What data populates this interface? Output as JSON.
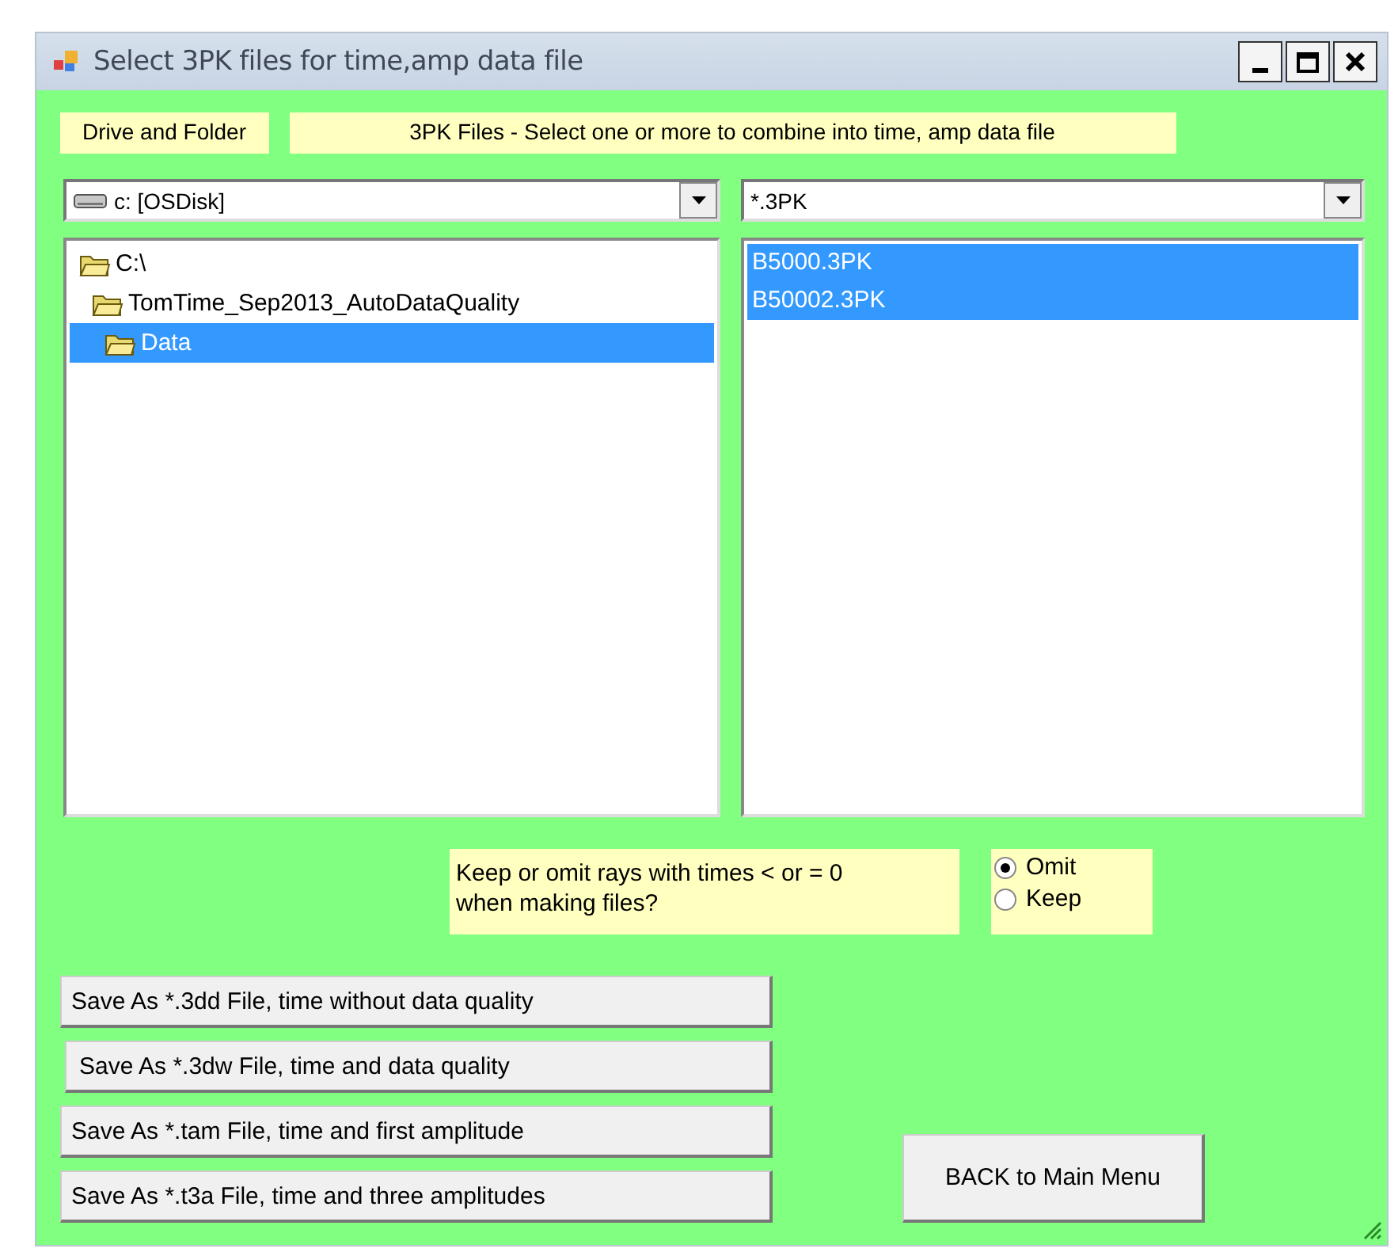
{
  "window": {
    "title": "Select  3PK  files  for  time,amp data file"
  },
  "drive_label": "Drive and Folder",
  "files_label": "3PK Files - Select one or more to combine into time, amp data file",
  "drive_combo": {
    "value": "c: [OSDisk]"
  },
  "filter_combo": {
    "value": "*.3PK"
  },
  "folder_tree": [
    {
      "label": "C:\\",
      "selected": false,
      "children": [
        {
          "label": "TomTime_Sep2013_AutoDataQuality",
          "selected": false,
          "children": [
            {
              "label": "Data",
              "selected": true
            }
          ]
        }
      ]
    }
  ],
  "files": [
    {
      "name": "B5000.3PK",
      "selected": true
    },
    {
      "name": "B50002.3PK",
      "selected": true
    }
  ],
  "omit_question": "Keep or omit rays with times < or = 0\nwhen making files?",
  "rays_options": [
    {
      "label": "Omit",
      "selected": true
    },
    {
      "label": "Keep",
      "selected": false
    }
  ],
  "save_buttons": [
    "Save As *.3dd File, time without data quality",
    "Save As *.3dw File, time and data quality",
    "Save As *.tam File, time and first amplitude",
    "Save As *.t3a File, time and three amplitudes"
  ],
  "back_button": "BACK to Main Menu"
}
